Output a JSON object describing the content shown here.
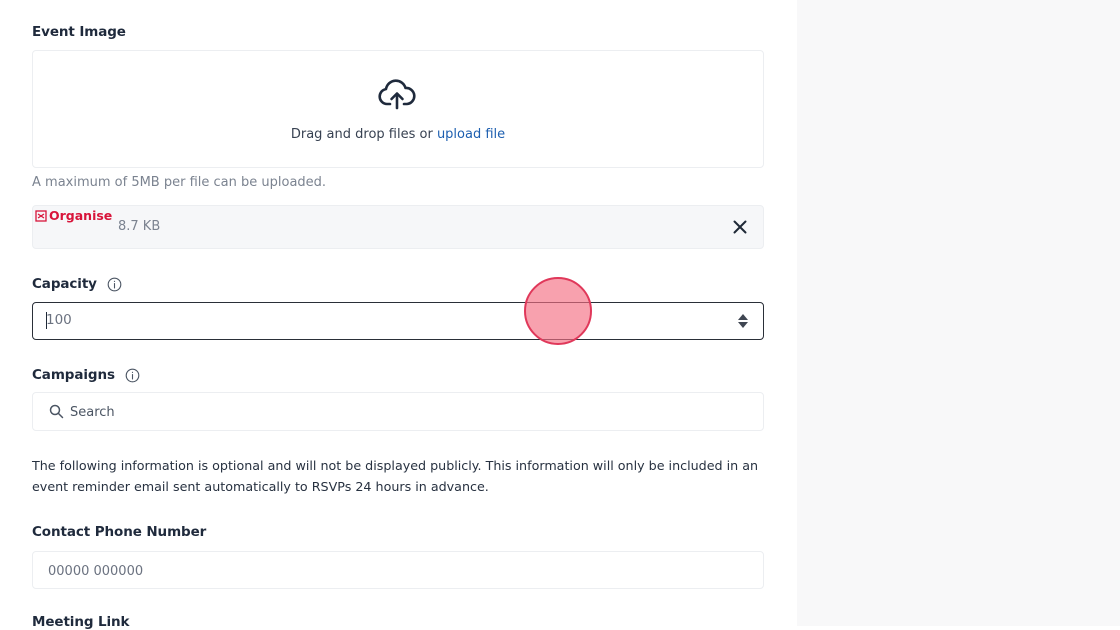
{
  "event_image": {
    "label": "Event Image",
    "drop_text": "Drag and drop files or ",
    "upload_link": "upload file",
    "hint": "A maximum of 5MB per file can be uploaded.",
    "file": {
      "logo_text": "Organise",
      "size": "8.7 KB"
    }
  },
  "capacity": {
    "label": "Capacity",
    "value": "100"
  },
  "campaigns": {
    "label": "Campaigns",
    "search_placeholder": "Search"
  },
  "info_text": "The following information is optional and will not be displayed publicly. This information will only be included in an event reminder email sent automatically to RSVPs 24 hours in advance.",
  "contact_phone": {
    "label": "Contact Phone Number",
    "placeholder": "00000 000000"
  },
  "meeting_link": {
    "label": "Meeting Link"
  },
  "colors": {
    "link": "#1d5fb0",
    "brand": "#d8143a",
    "cursor": "#e0385a"
  },
  "icons": [
    "upload-cloud-icon",
    "info-icon",
    "close-icon",
    "search-icon",
    "organise-logo-icon"
  ]
}
